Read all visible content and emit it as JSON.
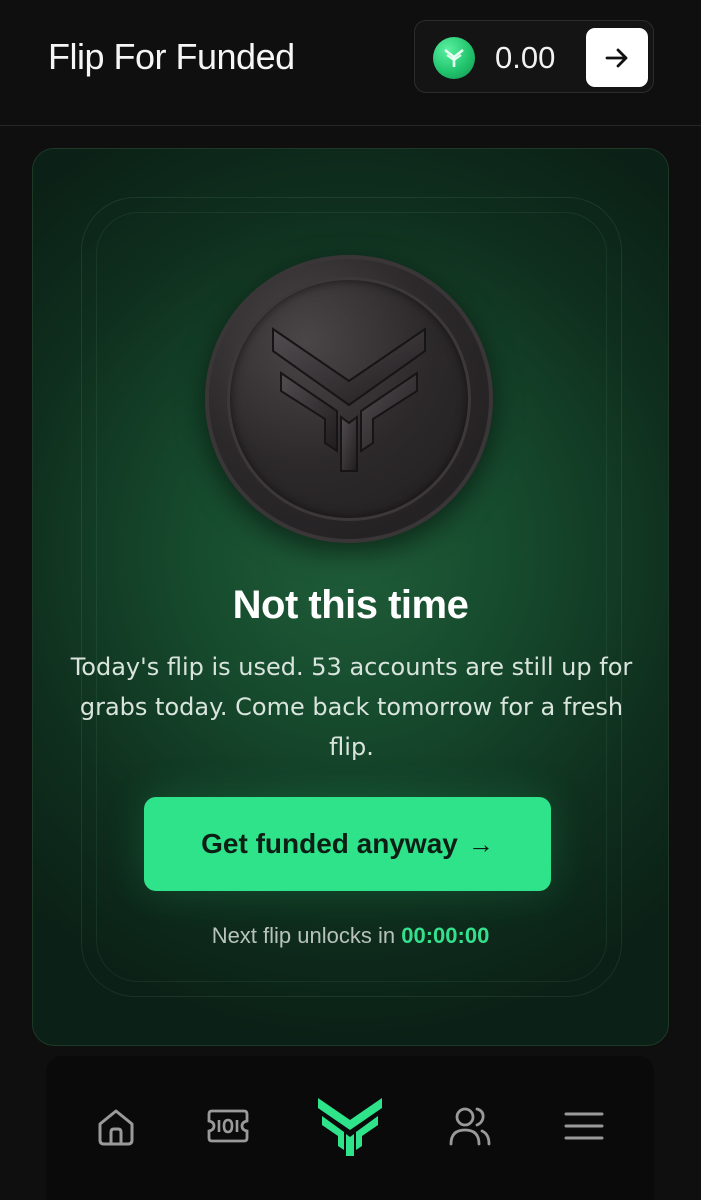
{
  "header": {
    "title": "Flip For Funded",
    "balance": "0.00",
    "token_icon": "token-logo-icon",
    "action_icon": "arrow-right-icon"
  },
  "result": {
    "title": "Not this time",
    "message": "Today's flip is used. 53 accounts are still up for grabs today. Come back tomorrow for a fresh flip.",
    "cta_label": "Get funded anyway",
    "cta_arrow": "→",
    "countdown_label": "Next flip unlocks in",
    "countdown_value": "00:00:00"
  },
  "nav": {
    "items": [
      {
        "icon": "home-icon",
        "active": false
      },
      {
        "icon": "ticket-icon",
        "active": false
      },
      {
        "icon": "logo-icon",
        "active": true
      },
      {
        "icon": "users-icon",
        "active": false
      },
      {
        "icon": "menu-icon",
        "active": false
      }
    ]
  },
  "colors": {
    "accent": "#2ee38a",
    "background": "#0f0f0f",
    "card": "#164a2d"
  }
}
